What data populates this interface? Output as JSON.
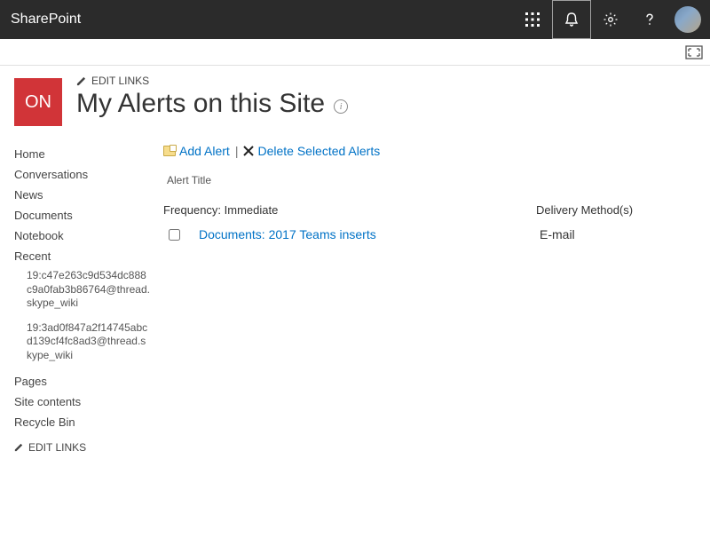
{
  "suite": {
    "title": "SharePoint"
  },
  "siteLogo": {
    "text": "ON"
  },
  "editLinks": {
    "label": "EDIT LINKS"
  },
  "page": {
    "title": "My Alerts on this Site"
  },
  "leftNav": {
    "items": {
      "home": "Home",
      "conversations": "Conversations",
      "news": "News",
      "documents": "Documents",
      "notebook": "Notebook",
      "recent": "Recent",
      "pages": "Pages",
      "siteContents": "Site contents",
      "recycleBin": "Recycle Bin"
    },
    "recentSub": {
      "item1": "19:c47e263c9d534dc888c9a0fab3b86764@thread.skype_wiki",
      "item2": "19:3ad0f847a2f14745abcd139cf4fc8ad3@thread.skype_wiki"
    },
    "editLinksBottom": "EDIT LINKS"
  },
  "actions": {
    "addAlert": "Add Alert",
    "separator": "|",
    "deleteSelected": "Delete Selected Alerts"
  },
  "table": {
    "alertTitleHeader": "Alert Title",
    "frequencyLabel": "Frequency: Immediate",
    "deliveryHeader": "Delivery Method(s)",
    "rows": {
      "row1": {
        "name": "Documents: 2017 Teams inserts",
        "delivery": "E-mail"
      }
    }
  }
}
